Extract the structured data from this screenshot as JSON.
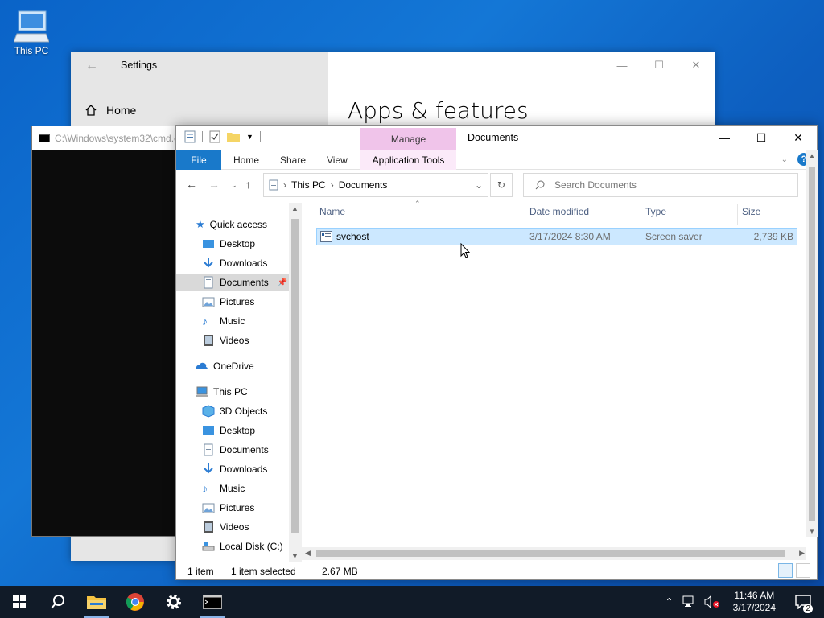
{
  "desktop": {
    "icon_label": "This PC"
  },
  "settings": {
    "title": "Settings",
    "home_label": "Home",
    "heading": "Apps & features"
  },
  "cmd": {
    "title": "C:\\Windows\\system32\\cmd.exe"
  },
  "explorer": {
    "title": "Documents",
    "context_tab": "Manage",
    "ribbon": {
      "file": "File",
      "tabs": [
        "Home",
        "Share",
        "View"
      ],
      "context_subtab": "Application Tools"
    },
    "address": {
      "segments": [
        "This PC",
        "Documents"
      ]
    },
    "search_placeholder": "Search Documents",
    "nav": {
      "quick_access": "Quick access",
      "quick_items": [
        {
          "label": "Desktop",
          "pinned": true
        },
        {
          "label": "Downloads",
          "pinned": true
        },
        {
          "label": "Documents",
          "pinned": true,
          "selected": true
        },
        {
          "label": "Pictures",
          "pinned": true
        },
        {
          "label": "Music",
          "pinned": false
        },
        {
          "label": "Videos",
          "pinned": false
        }
      ],
      "onedrive": "OneDrive",
      "this_pc": "This PC",
      "pc_items": [
        "3D Objects",
        "Desktop",
        "Documents",
        "Downloads",
        "Music",
        "Pictures",
        "Videos",
        "Local Disk (C:)"
      ]
    },
    "columns": [
      "Name",
      "Date modified",
      "Type",
      "Size"
    ],
    "files": [
      {
        "name": "svchost",
        "date": "3/17/2024 8:30 AM",
        "type": "Screen saver",
        "size": "2,739 KB"
      }
    ],
    "status": {
      "count": "1 item",
      "selected": "1 item selected",
      "size": "2.67 MB"
    }
  },
  "taskbar": {
    "time": "11:46 AM",
    "date": "3/17/2024",
    "notification_count": "2"
  },
  "colors": {
    "accent": "#1979ca",
    "selection": "#cce8ff",
    "manage_tab": "#f0c4ea"
  }
}
